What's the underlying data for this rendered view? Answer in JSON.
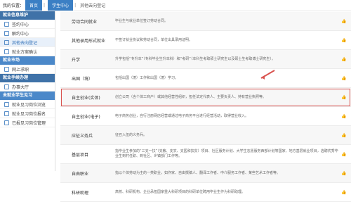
{
  "breadcrumb": {
    "prefix": "我的位置：",
    "home": "首页",
    "section": "学生中心",
    "current": "其他去向登记"
  },
  "sidebar": {
    "sections": [
      {
        "title": "就业信息维护",
        "style": "dark",
        "items": [
          "签约中心",
          "解约中心",
          "其他去向登记",
          "就业方案确认"
        ]
      },
      {
        "title": "就业市场",
        "style": "light",
        "items": [
          "网上求职"
        ]
      },
      {
        "title": "就业手续办理",
        "style": "dark",
        "items": [
          "办事大厅"
        ]
      },
      {
        "title": "未就业学生见习",
        "style": "light",
        "items": [
          "就业见习岗位浏览",
          "就业见习岗位报名",
          "已报见习岗位管理"
        ]
      }
    ],
    "active": "其他去向登记"
  },
  "main": {
    "rows": [
      {
        "name": "劳动合同就业",
        "desc": "毕业生与就业单位签订劳动合同。"
      },
      {
        "name": "其他录用形式就业",
        "desc": "不签订就业协议和劳动合同，单位出具录用证明。"
      },
      {
        "name": "升学",
        "desc": "升学包括“专升本”（专科毕业生升本科）和“考研”（本科生考取硕士研究生以及硕士生考取博士研究生）。"
      },
      {
        "name": "出国（境）",
        "desc": "包括出国（境）工作和出国（境）学习。"
      },
      {
        "name": "自主创业(实体)",
        "desc": "创立公司（含个体工商户）或其他经营性组织，担任法定代表人、主要负责人、持有营业执照等。",
        "selected": true
      },
      {
        "name": "自主创业(电子)",
        "desc": "电子商务创业，自行注册网店经营或通过电子商务平台进行经营活动，取得营业收入。"
      },
      {
        "name": "应征义务兵",
        "desc": "征召入伍的义务兵。"
      },
      {
        "name": "基层项目",
        "desc": "指毕业生参加的“三支一扶”（支教、支农、支医和扶贫）项目、社区服务计划、大学生志愿服务西部计划等国家、地方基层就业项目，选聘优秀毕业生到村任职、到社区、乡镇部门工作等。"
      },
      {
        "name": "自由职业",
        "desc": "指以个体劳动为主的一类职业，如作家、自由撰稿人、翻译工作者、中介服务工作者、某些艺术工作者等。"
      },
      {
        "name": "科研助理",
        "desc": "高校、科研机构、企业承担国家重大科研项目的科研单位聘用毕业生作为科研助理。"
      }
    ]
  }
}
